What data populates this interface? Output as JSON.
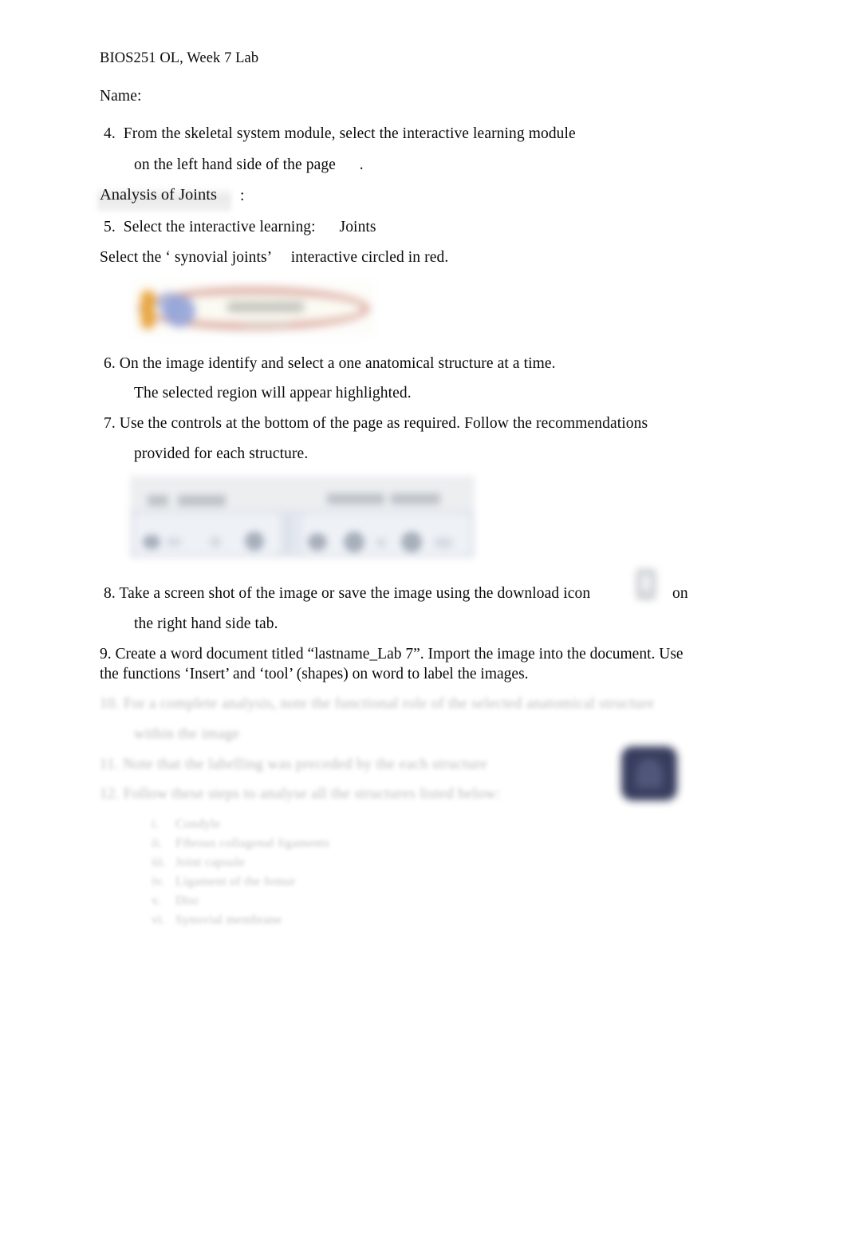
{
  "document": {
    "header": "BIOS251 OL, Week 7 Lab",
    "name_field_label": "Name:",
    "name_field_value": ""
  },
  "steps": {
    "step4": {
      "line1": "4.  From the skeletal system module, select the interactive learning module",
      "line2": "on the left hand side of the page      ."
    },
    "heading": {
      "label": "Analysis of Joints",
      "colon": ":"
    },
    "step5": "5.  Select the interactive learning:      Joints",
    "select_instruction": "Select the ‘ synovial joints’     interactive circled in red.",
    "step6": {
      "line1": "6. On the image identify and select a one anatomical structure at a time.",
      "line2": "The selected region will appear highlighted."
    },
    "step7": {
      "line1": "7. Use the controls at the bottom of the page as required. Follow the recommendations",
      "line2": "provided for each structure."
    },
    "step8": {
      "line1_a": "8. Take a screen shot of the image or save the image using the download icon",
      "line1_b": "on",
      "line2": "the right hand side tab."
    },
    "step9": "9.  Create a word document titled “lastname_Lab 7”. Import the image into the document. Use the functions ‘Insert’ and ‘tool’ (shapes) on word to label the images."
  },
  "redacted": {
    "note": "These lines are blurred beyond legibility in the source screenshot.",
    "step10_line1": "10. For a complete analysis, note the functional role of the selected anatomical structure",
    "step10_line2": "within the image",
    "step11": "11. Note that the labelling was preceded by the each structure",
    "step12": "12. Follow these steps to analyse all the structures listed below:",
    "list": [
      "Condyle",
      "Fibrous collagenal ligaments",
      "Joint capsule",
      "Ligament of the femur",
      "Disc",
      "Synovial membrane"
    ]
  },
  "images": {
    "banner": {
      "name": "synovial-joints-banner-screenshot",
      "description": "Blurred screenshot of a menu row with an orange bar, blue icon and gray label, circled in red",
      "colors": {
        "orange_bar": "#e9a53f",
        "blue_icon": "#93a3d8",
        "red_circle": "#d8a196",
        "background": "#fbfaf3",
        "label_gray": "#b8b8b2"
      }
    },
    "toolbar": {
      "name": "anatomy-controls-toolbar-screenshot",
      "description": "Blurred screenshot of two control panels with header labels and rows of icon buttons",
      "labels": [
        "Layer Controls",
        "Anatomy Controls"
      ],
      "colors": {
        "panel": "#eef1f6",
        "row_background": "#e3e7ee",
        "header_background": "#eceef0",
        "icon": "#9aa3b0"
      }
    },
    "download_icon": {
      "name": "download-icon",
      "description": "Faint blurred small gray download icon",
      "color": "#a8acb3"
    },
    "app_icon": {
      "name": "app-icon",
      "description": "Blurred dark navy rounded-square application icon",
      "color": "#2d3356"
    }
  }
}
